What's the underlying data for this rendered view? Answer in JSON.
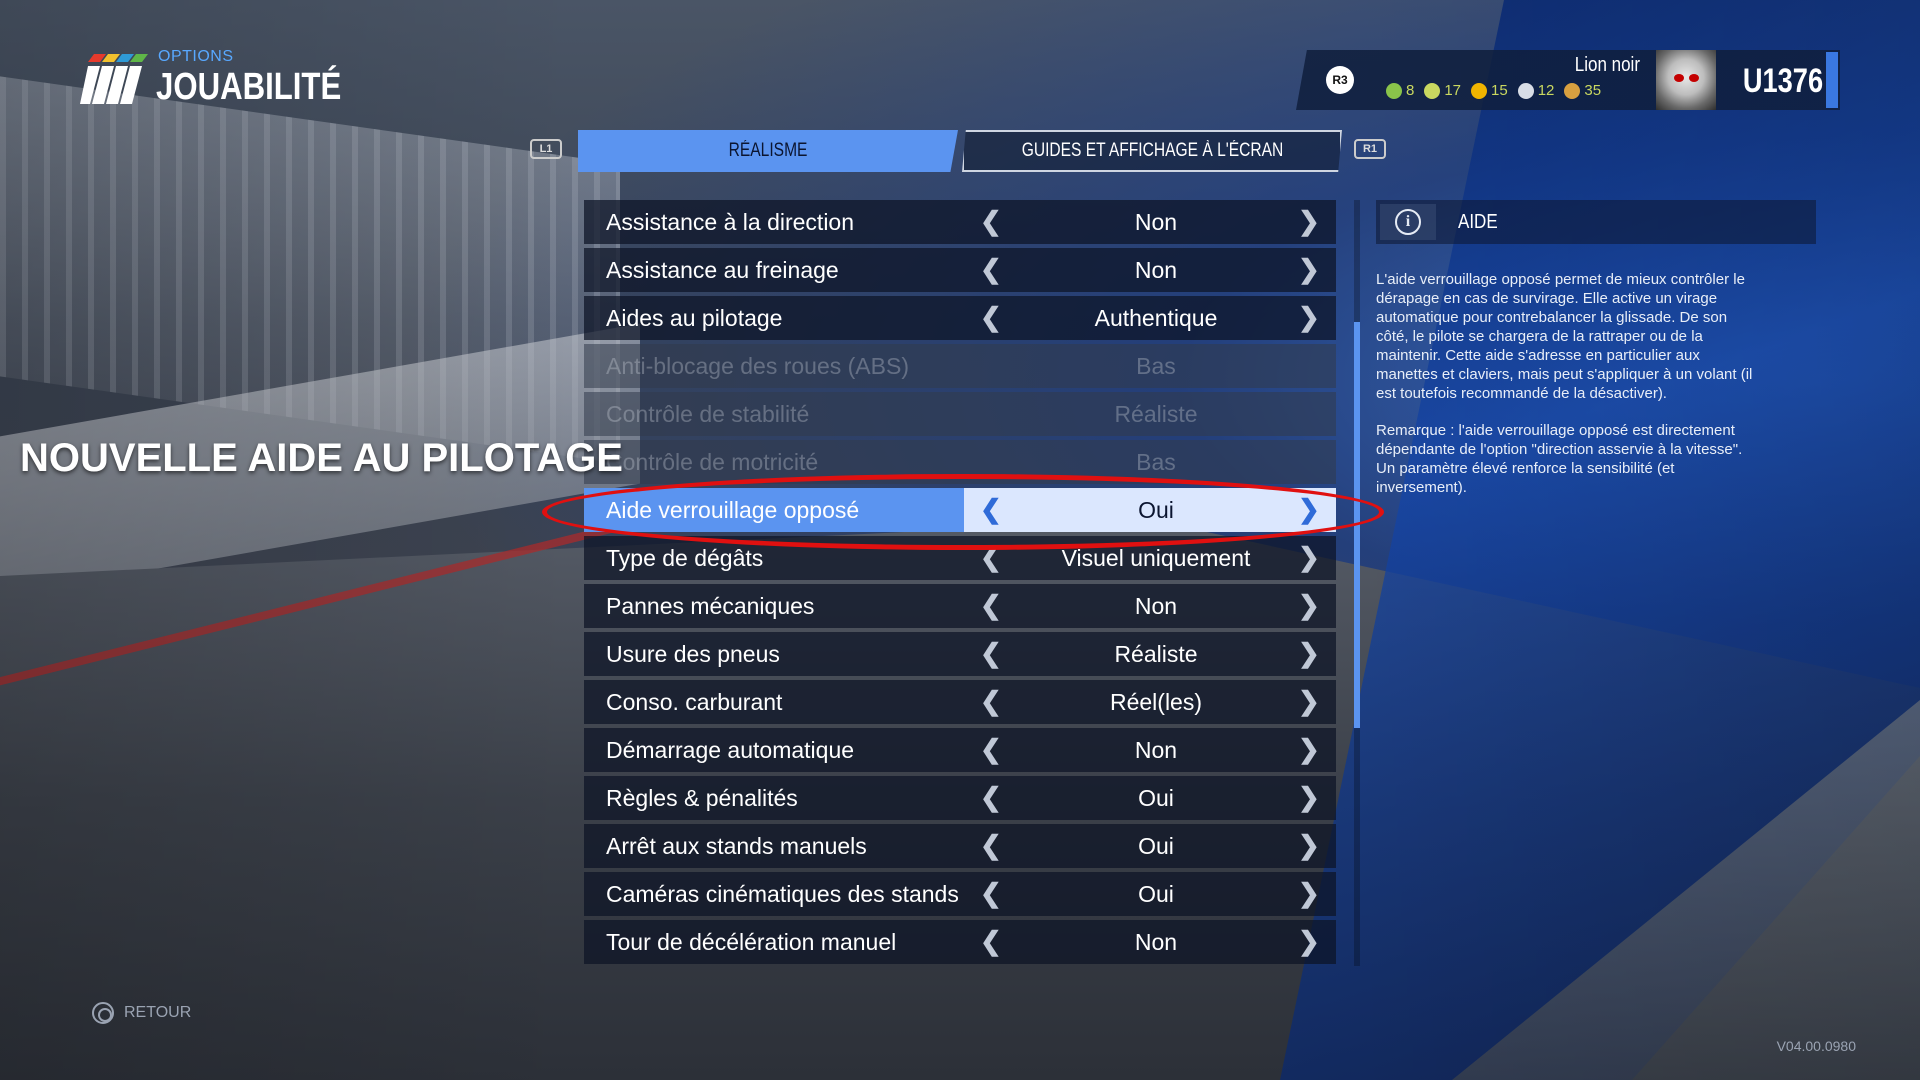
{
  "header": {
    "section": "OPTIONS",
    "title": "JOUABILITÉ"
  },
  "profile": {
    "button_hint": "R3",
    "name": "Lion noir",
    "stats": [
      {
        "icon": "wheel-icon",
        "value": "8",
        "color": "#8ac44a"
      },
      {
        "icon": "trophy-icon",
        "value": "17",
        "color": "#c9d860"
      },
      {
        "icon": "helmet-icon",
        "value": "15",
        "color": "#f0b400"
      },
      {
        "icon": "speed-icon",
        "value": "12",
        "color": "#d8dde6"
      },
      {
        "icon": "medal-icon",
        "value": "35",
        "color": "#d8a040"
      }
    ],
    "rating": "U1376"
  },
  "tabs": {
    "left_bumper": "L1",
    "right_bumper": "R1",
    "items": [
      {
        "label": "Réalisme",
        "active": true
      },
      {
        "label": "Guides et affichage à l'écran",
        "active": false
      }
    ]
  },
  "settings": [
    {
      "label": "Assistance à la direction",
      "value": "Non",
      "state": "normal"
    },
    {
      "label": "Assistance au freinage",
      "value": "Non",
      "state": "normal"
    },
    {
      "label": "Aides au pilotage",
      "value": "Authentique",
      "state": "normal"
    },
    {
      "label": "Anti-blocage des roues (ABS)",
      "value": "Bas",
      "state": "disabled"
    },
    {
      "label": "Contrôle de stabilité",
      "value": "Réaliste",
      "state": "disabled"
    },
    {
      "label": "Contrôle de motricité",
      "value": "Bas",
      "state": "disabled"
    },
    {
      "label": "Aide verrouillage opposé",
      "value": "Oui",
      "state": "selected"
    },
    {
      "label": "Type de dégâts",
      "value": "Visuel uniquement",
      "state": "normal"
    },
    {
      "label": "Pannes mécaniques",
      "value": "Non",
      "state": "normal"
    },
    {
      "label": "Usure des pneus",
      "value": "Réaliste",
      "state": "normal"
    },
    {
      "label": "Conso. carburant",
      "value": "Réel(les)",
      "state": "normal"
    },
    {
      "label": "Démarrage automatique",
      "value": "Non",
      "state": "normal"
    },
    {
      "label": "Règles & pénalités",
      "value": "Oui",
      "state": "normal"
    },
    {
      "label": "Arrêt aux stands manuels",
      "value": "Oui",
      "state": "normal"
    },
    {
      "label": "Caméras cinématiques des stands",
      "value": "Oui",
      "state": "normal"
    },
    {
      "label": "Tour de décélération manuel",
      "value": "Non",
      "state": "normal"
    }
  ],
  "annotation": "NOUVELLE AIDE AU PILOTAGE",
  "help": {
    "title": "AIDE",
    "paragraphs": [
      "L'aide verrouillage opposé permet de mieux contrôler le dérapage en cas de survirage. Elle active un virage automatique pour contrebalancer la glissade. De son côté, le pilote se chargera de la rattraper ou de la maintenir. Cette aide s'adresse en particulier aux manettes et claviers, mais peut s'appliquer à un volant (il est toutefois recommandé de la désactiver).",
      "Remarque : l'aide verrouillage opposé est directement dépendante de l'option \"direction asservie à la vitesse\". Un paramètre élevé renforce la sensibilité (et inversement)."
    ]
  },
  "footer": {
    "back_label": "RETOUR",
    "version": "V04.00.0980"
  },
  "colors": {
    "accent": "#5b94f0",
    "annotation_ring": "#e01010"
  }
}
